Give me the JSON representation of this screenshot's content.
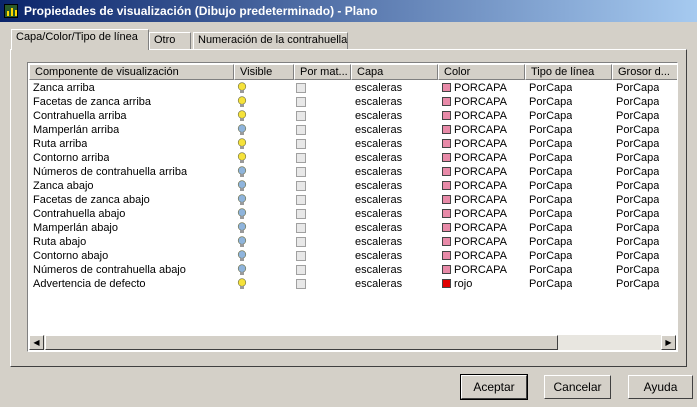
{
  "window": {
    "title": "Propiedades de visualización (Dibujo predeterminado) - Plano"
  },
  "tabs": [
    {
      "label": "Capa/Color/Tipo de línea",
      "active": true
    },
    {
      "label": "Otro"
    },
    {
      "label": "Numeración de la contrahuella"
    }
  ],
  "columns": [
    "Componente de visualización",
    "Visible",
    "Por mat...",
    "Capa",
    "Color",
    "Tipo de línea",
    "Grosor d..."
  ],
  "rows": [
    {
      "name": "Zanca arriba",
      "visible": true,
      "capa": "escaleras",
      "color": "PORCAPA",
      "color_hex": "#e88aa8",
      "linetype": "PorCapa",
      "lineweight": "PorCapa"
    },
    {
      "name": "Facetas de zanca arriba",
      "visible": true,
      "capa": "escaleras",
      "color": "PORCAPA",
      "color_hex": "#e88aa8",
      "linetype": "PorCapa",
      "lineweight": "PorCapa"
    },
    {
      "name": "Contrahuella arriba",
      "visible": true,
      "capa": "escaleras",
      "color": "PORCAPA",
      "color_hex": "#e88aa8",
      "linetype": "PorCapa",
      "lineweight": "PorCapa"
    },
    {
      "name": "Mamperlán arriba",
      "visible": false,
      "capa": "escaleras",
      "color": "PORCAPA",
      "color_hex": "#e88aa8",
      "linetype": "PorCapa",
      "lineweight": "PorCapa"
    },
    {
      "name": "Ruta arriba",
      "visible": true,
      "capa": "escaleras",
      "color": "PORCAPA",
      "color_hex": "#e88aa8",
      "linetype": "PorCapa",
      "lineweight": "PorCapa"
    },
    {
      "name": "Contorno arriba",
      "visible": true,
      "capa": "escaleras",
      "color": "PORCAPA",
      "color_hex": "#e88aa8",
      "linetype": "PorCapa",
      "lineweight": "PorCapa"
    },
    {
      "name": "Números de contrahuella arriba",
      "visible": false,
      "capa": "escaleras",
      "color": "PORCAPA",
      "color_hex": "#e88aa8",
      "linetype": "PorCapa",
      "lineweight": "PorCapa"
    },
    {
      "name": "Zanca abajo",
      "visible": false,
      "capa": "escaleras",
      "color": "PORCAPA",
      "color_hex": "#e88aa8",
      "linetype": "PorCapa",
      "lineweight": "PorCapa"
    },
    {
      "name": "Facetas de zanca abajo",
      "visible": false,
      "capa": "escaleras",
      "color": "PORCAPA",
      "color_hex": "#e88aa8",
      "linetype": "PorCapa",
      "lineweight": "PorCapa"
    },
    {
      "name": "Contrahuella abajo",
      "visible": false,
      "capa": "escaleras",
      "color": "PORCAPA",
      "color_hex": "#e88aa8",
      "linetype": "PorCapa",
      "lineweight": "PorCapa"
    },
    {
      "name": "Mamperlán abajo",
      "visible": false,
      "capa": "escaleras",
      "color": "PORCAPA",
      "color_hex": "#e88aa8",
      "linetype": "PorCapa",
      "lineweight": "PorCapa"
    },
    {
      "name": "Ruta abajo",
      "visible": false,
      "capa": "escaleras",
      "color": "PORCAPA",
      "color_hex": "#e88aa8",
      "linetype": "PorCapa",
      "lineweight": "PorCapa"
    },
    {
      "name": "Contorno abajo",
      "visible": false,
      "capa": "escaleras",
      "color": "PORCAPA",
      "color_hex": "#e88aa8",
      "linetype": "PorCapa",
      "lineweight": "PorCapa"
    },
    {
      "name": "Números de contrahuella abajo",
      "visible": false,
      "capa": "escaleras",
      "color": "PORCAPA",
      "color_hex": "#e88aa8",
      "linetype": "PorCapa",
      "lineweight": "PorCapa"
    },
    {
      "name": "Advertencia de defecto",
      "visible": true,
      "capa": "escaleras",
      "color": "rojo",
      "color_hex": "#e00000",
      "linetype": "PorCapa",
      "lineweight": "PorCapa"
    }
  ],
  "colors": {
    "bulb_on": "#f6e23a",
    "bulb_off": "#8fb4dc"
  },
  "buttons": {
    "accept": "Aceptar",
    "cancel": "Cancelar",
    "help": "Ayuda"
  }
}
